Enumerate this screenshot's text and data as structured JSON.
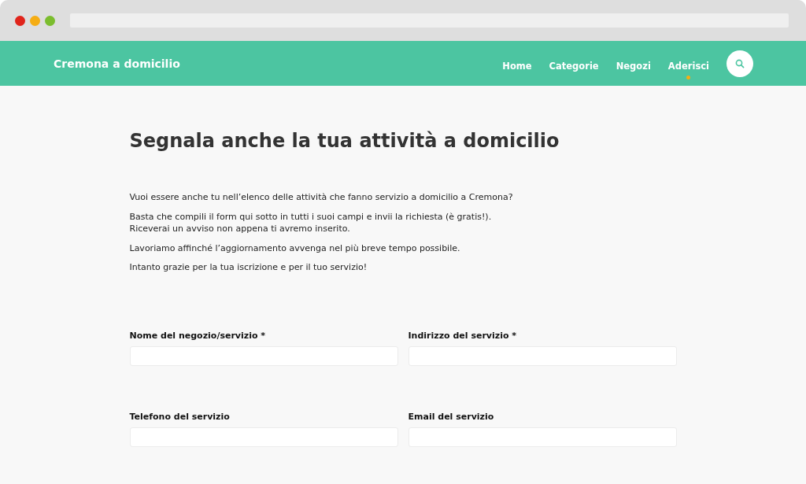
{
  "site": {
    "title": "Cremona a domicilio"
  },
  "nav": [
    {
      "label": "Home",
      "selected": false
    },
    {
      "label": "Categorie",
      "selected": false
    },
    {
      "label": "Negozi",
      "selected": false
    },
    {
      "label": "Aderisci",
      "selected": true
    }
  ],
  "page": {
    "heading": "Segnala anche la tua attività a domicilio",
    "paragraphs": [
      "Vuoi essere anche tu nell’elenco delle attività che fanno servizio a domicilio a Cremona?",
      "Basta che compili il form qui sotto in tutti i suoi campi e invii la richiesta (è gratis!).\nRiceverai un avviso non appena ti avremo inserito.",
      "Lavoriamo affinché l’aggiornamento avvenga nel più breve tempo possibile.",
      "Intanto grazie per la tua iscrizione e per il tuo servizio!"
    ]
  },
  "form": {
    "fields": [
      {
        "label": "Nome del negozio/servizio *"
      },
      {
        "label": "Indirizzo del servizio *"
      },
      {
        "label": "Telefono del servizio"
      },
      {
        "label": "Email del servizio"
      }
    ]
  }
}
